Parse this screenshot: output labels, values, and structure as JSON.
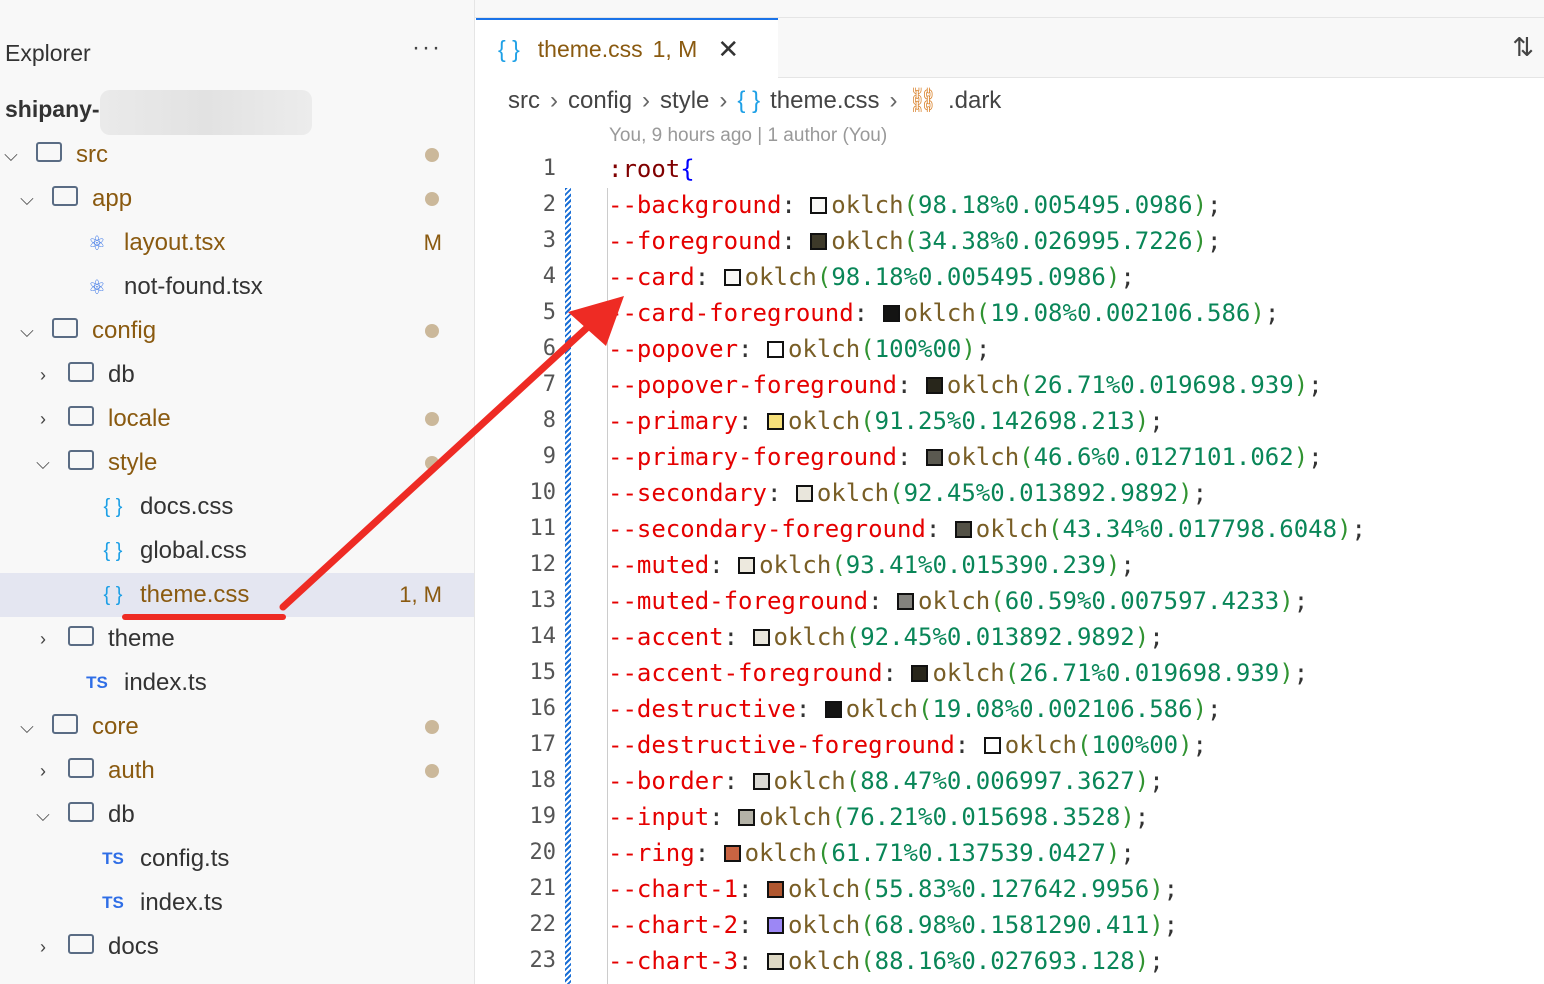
{
  "sidebar": {
    "title": "Explorer",
    "more": "···",
    "workspace": "shipany-",
    "rows": [
      {
        "label": "src",
        "depth": 0,
        "chev": "v",
        "kind": "folder",
        "dot": true,
        "mod": true
      },
      {
        "label": "app",
        "depth": 1,
        "chev": "v",
        "kind": "folder",
        "dot": true,
        "mod": true
      },
      {
        "label": "layout.tsx",
        "depth": 2,
        "kind": "react",
        "badge": "M",
        "mod": true
      },
      {
        "label": "not-found.tsx",
        "depth": 2,
        "kind": "react"
      },
      {
        "label": "config",
        "depth": 1,
        "chev": "v",
        "kind": "folder",
        "dot": true,
        "mod": true
      },
      {
        "label": "db",
        "depth": 2,
        "chev": ">",
        "kind": "folder"
      },
      {
        "label": "locale",
        "depth": 2,
        "chev": ">",
        "kind": "folder",
        "dot": true,
        "mod": true
      },
      {
        "label": "style",
        "depth": 2,
        "chev": "v",
        "kind": "folder",
        "dot": true,
        "mod": true
      },
      {
        "label": "docs.css",
        "depth": 3,
        "kind": "css"
      },
      {
        "label": "global.css",
        "depth": 3,
        "kind": "css"
      },
      {
        "label": "theme.css",
        "depth": 3,
        "kind": "css",
        "badge": "1, M",
        "mod": true,
        "selected": true
      },
      {
        "label": "theme",
        "depth": 2,
        "chev": ">",
        "kind": "folder"
      },
      {
        "label": "index.ts",
        "depth": 2,
        "kind": "ts"
      },
      {
        "label": "core",
        "depth": 1,
        "chev": "v",
        "kind": "folder",
        "dot": true,
        "mod": true
      },
      {
        "label": "auth",
        "depth": 2,
        "chev": ">",
        "kind": "folder",
        "dot": true,
        "mod": true
      },
      {
        "label": "db",
        "depth": 2,
        "chev": "v",
        "kind": "folder"
      },
      {
        "label": "config.ts",
        "depth": 3,
        "kind": "ts"
      },
      {
        "label": "index.ts",
        "depth": 3,
        "kind": "ts"
      },
      {
        "label": "docs",
        "depth": 2,
        "chev": ">",
        "kind": "folder"
      }
    ]
  },
  "tab": {
    "icon": "{ }",
    "name": "theme.css",
    "status": "1, M",
    "close": "✕"
  },
  "breadcrumbs": [
    "src",
    "config",
    "style",
    "theme.css",
    ".dark"
  ],
  "blame": "You, 9 hours ago | 1 author (You)",
  "code": {
    "selector": ":root",
    "brace": "{",
    "vars": [
      [
        "--background",
        "98.18%",
        "0.0054",
        "95.0986",
        "#f9f8f6"
      ],
      [
        "--foreground",
        "34.38%",
        "0.0269",
        "95.7226",
        "#3d3929"
      ],
      [
        "--card",
        "98.18%",
        "0.0054",
        "95.0986",
        "#f9f8f6"
      ],
      [
        "--card-foreground",
        "19.08%",
        "0.002",
        "106.586",
        "#141413"
      ],
      [
        "--popover",
        "100%",
        "0",
        "0",
        "#ffffff"
      ],
      [
        "--popover-foreground",
        "26.71%",
        "0.0196",
        "98.939",
        "#28261b"
      ],
      [
        "--primary",
        "91.25%",
        "0.1426",
        "98.213",
        "#f6e07a"
      ],
      [
        "--primary-foreground",
        "46.6%",
        "0.0127",
        "101.062",
        "#5a5950"
      ],
      [
        "--secondary",
        "92.45%",
        "0.0138",
        "92.9892",
        "#e9e6dc"
      ],
      [
        "--secondary-foreground",
        "43.34%",
        "0.0177",
        "98.6048",
        "#535146"
      ],
      [
        "--muted",
        "93.41%",
        "0.0153",
        "90.239",
        "#ede9de"
      ],
      [
        "--muted-foreground",
        "60.59%",
        "0.0075",
        "97.4233",
        "#83827d"
      ],
      [
        "--accent",
        "92.45%",
        "0.0138",
        "92.9892",
        "#e9e6dc"
      ],
      [
        "--accent-foreground",
        "26.71%",
        "0.0196",
        "98.939",
        "#28261b"
      ],
      [
        "--destructive",
        "19.08%",
        "0.002",
        "106.586",
        "#141413"
      ],
      [
        "--destructive-foreground",
        "100%",
        "0",
        "0",
        "#ffffff"
      ],
      [
        "--border",
        "88.47%",
        "0.0069",
        "97.3627",
        "#dad9d4"
      ],
      [
        "--input",
        "76.21%",
        "0.0156",
        "98.3528",
        "#b4b2a7"
      ],
      [
        "--ring",
        "61.71%",
        "0.1375",
        "39.0427",
        "#c96442"
      ],
      [
        "--chart-1",
        "55.83%",
        "0.1276",
        "42.9956",
        "#b05730"
      ],
      [
        "--chart-2",
        "68.98%",
        "0.1581",
        "290.411",
        "#9c87f5"
      ],
      [
        "--chart-3",
        "88.16%",
        "0.0276",
        "93.128",
        "#ded8c4"
      ]
    ]
  }
}
